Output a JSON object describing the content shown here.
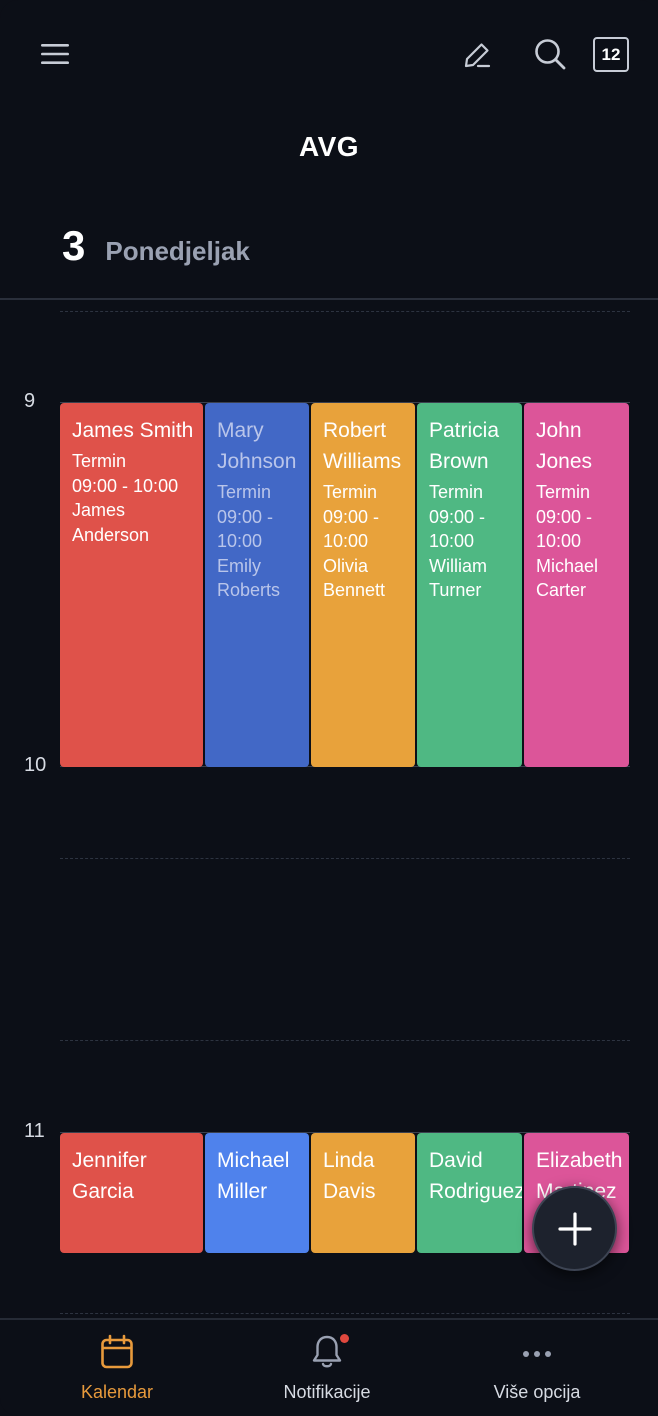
{
  "header": {
    "month": "AVG",
    "day_number": "3",
    "day_name": "Ponedjeljak",
    "date_badge": "12",
    "icons": [
      "menu-icon",
      "edit-icon",
      "search-icon",
      "calendar-date-icon"
    ]
  },
  "timeline": {
    "hours": [
      "9",
      "10",
      "11"
    ]
  },
  "events_row1": [
    {
      "title": "James Smith",
      "type": "Termin",
      "time": "09:00 - 10:00",
      "person": "James Anderson",
      "color": "#df524a"
    },
    {
      "title": "Mary Johnson",
      "type": "Termin",
      "time": "09:00 - 10:00",
      "person": "Emily Roberts",
      "color": "#4268c6"
    },
    {
      "title": "Robert Williams",
      "type": "Termin",
      "time": "09:00 - 10:00",
      "person": "Olivia Bennett",
      "color": "#e8a23b"
    },
    {
      "title": "Patricia Brown",
      "type": "Termin",
      "time": "09:00 - 10:00",
      "person": "William Turner",
      "color": "#4fb883"
    },
    {
      "title": "John Jones",
      "type": "Termin",
      "time": "09:00 - 10:00",
      "person": "Michael Carter",
      "color": "#dc5599"
    }
  ],
  "events_row2": [
    {
      "title": "Jennifer Garcia",
      "color": "#df524a"
    },
    {
      "title": "Michael Miller",
      "color": "#4f82ec"
    },
    {
      "title": "Linda Davis",
      "color": "#e8a23b"
    },
    {
      "title": "David Rodriguez",
      "color": "#4fb883"
    },
    {
      "title": "Elizabeth Martinez",
      "color": "#dc5599"
    }
  ],
  "fab": {
    "icon": "plus-icon"
  },
  "bottom_nav": {
    "items": [
      {
        "label": "Kalendar",
        "icon": "calendar-icon",
        "active": true,
        "color": "#e89a3c"
      },
      {
        "label": "Notifikacije",
        "icon": "bell-icon",
        "active": false,
        "badge": true
      },
      {
        "label": "Više opcija",
        "icon": "more-icon",
        "active": false
      }
    ]
  },
  "colors": {
    "background": "#0c0f17",
    "accent": "#e89a3c",
    "notification_dot": "#e0483e"
  }
}
